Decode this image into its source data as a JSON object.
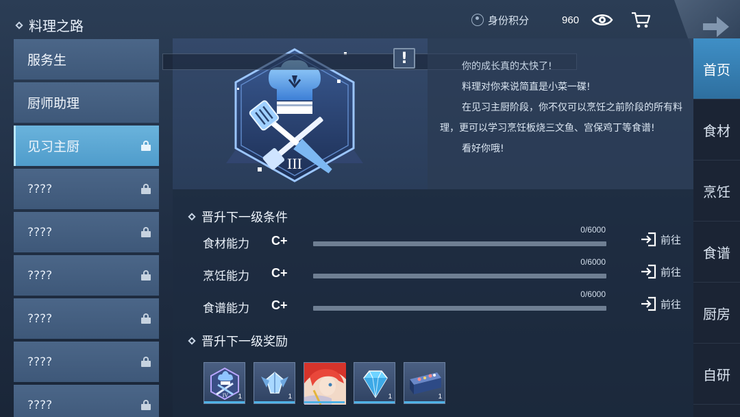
{
  "header": {
    "title": "料理之路",
    "identity_label": "身份积分",
    "score": "960"
  },
  "ranks": [
    {
      "label": "服务生",
      "locked": false,
      "active": false
    },
    {
      "label": "厨师助理",
      "locked": false,
      "active": false
    },
    {
      "label": "见习主厨",
      "locked": true,
      "active": true
    },
    {
      "label": "????",
      "locked": true,
      "active": false
    },
    {
      "label": "????",
      "locked": true,
      "active": false
    },
    {
      "label": "????",
      "locked": true,
      "active": false
    },
    {
      "label": "????",
      "locked": true,
      "active": false
    },
    {
      "label": "????",
      "locked": true,
      "active": false
    },
    {
      "label": "????",
      "locked": true,
      "active": false
    }
  ],
  "badge": {
    "numeral": "III",
    "warn": "!"
  },
  "description": [
    "你的成长真的太快了!",
    "料理对你来说简直是小菜一碟!",
    "在见习主厨阶段，你不仅可以烹饪之前阶段的所有料理，更可以学习烹饪板烧三文鱼、宫保鸡丁等食谱!",
    "看好你哦!"
  ],
  "conditions": {
    "title": "晋升下一级条件",
    "items": [
      {
        "label": "食材能力",
        "grade": "C+",
        "count": "0/6000",
        "progress": 0,
        "goto": "前往"
      },
      {
        "label": "烹饪能力",
        "grade": "C+",
        "count": "0/6000",
        "progress": 0,
        "goto": "前往"
      },
      {
        "label": "食谱能力",
        "grade": "C+",
        "count": "0/6000",
        "progress": 0,
        "goto": "前往"
      }
    ]
  },
  "rewards": {
    "title": "晋升下一级奖励",
    "items": [
      {
        "icon": "chef-badge-iv-icon",
        "qty": "1",
        "badge_numeral": "IV"
      },
      {
        "icon": "crystal-emblem-icon",
        "qty": "1"
      },
      {
        "icon": "character-portrait",
        "qty": ""
      },
      {
        "icon": "diamond-icon",
        "qty": "1"
      },
      {
        "icon": "gift-box-icon",
        "qty": "1"
      }
    ]
  },
  "nav": [
    {
      "label": "首页",
      "active": true
    },
    {
      "label": "食材",
      "active": false
    },
    {
      "label": "烹饪",
      "active": false
    },
    {
      "label": "食谱",
      "active": false
    },
    {
      "label": "厨房",
      "active": false
    },
    {
      "label": "自研",
      "active": false
    }
  ],
  "colors": {
    "accent": "#4fa5d6",
    "background": "#243550",
    "panel": "#3e5879"
  }
}
